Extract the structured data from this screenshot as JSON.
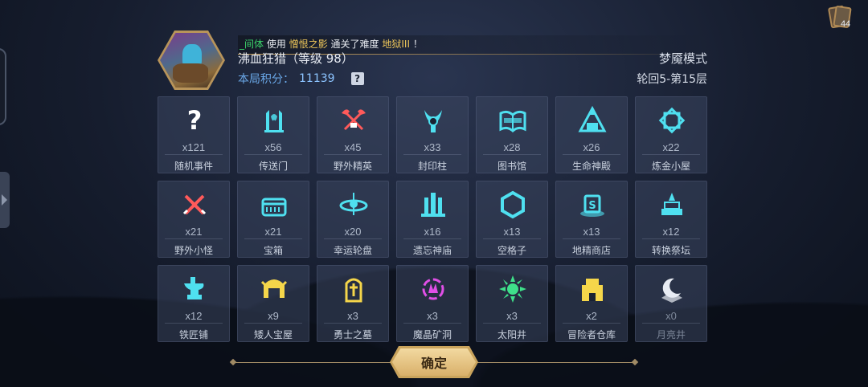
{
  "header": {
    "broadcast": {
      "player": "_间体",
      "used": "使用",
      "item": "憎恨之影",
      "middle": "通关了难度",
      "difficulty": "地狱III",
      "end": "！"
    },
    "player_name": "沸血狂猎（等级 98）",
    "mode": "梦魇模式",
    "score_label": "本局积分：",
    "score_value": "11139",
    "help_label": "?",
    "round": "轮回5-第15层",
    "cards_count": "44"
  },
  "events": [
    {
      "name": "随机事件",
      "count": "x121",
      "icon": "question-icon",
      "color": "#ffffff"
    },
    {
      "name": "传送门",
      "count": "x56",
      "icon": "portal-icon",
      "color": "#4fe0f0"
    },
    {
      "name": "野外精英",
      "count": "x45",
      "icon": "crossed-axes-icon",
      "color": "#ff5a5a"
    },
    {
      "name": "封印柱",
      "count": "x33",
      "icon": "seal-pillar-icon",
      "color": "#4fe0f0"
    },
    {
      "name": "图书馆",
      "count": "x28",
      "icon": "book-icon",
      "color": "#4fe0f0"
    },
    {
      "name": "生命神殿",
      "count": "x26",
      "icon": "temple-icon",
      "color": "#4fe0f0"
    },
    {
      "name": "炼金小屋",
      "count": "x22",
      "icon": "alchemy-icon",
      "color": "#4fe0f0"
    },
    {
      "name": "野外小怪",
      "count": "x21",
      "icon": "crossed-swords-icon",
      "color": "#ff5a5a"
    },
    {
      "name": "宝箱",
      "count": "x21",
      "icon": "chest-icon",
      "color": "#4fe0f0"
    },
    {
      "name": "幸运轮盘",
      "count": "x20",
      "icon": "wheel-icon",
      "color": "#4fe0f0"
    },
    {
      "name": "遗忘神庙",
      "count": "x16",
      "icon": "shrine-icon",
      "color": "#4fe0f0"
    },
    {
      "name": "空格子",
      "count": "x13",
      "icon": "hexagon-icon",
      "color": "#4fe0f0"
    },
    {
      "name": "地精商店",
      "count": "x13",
      "icon": "shop-icon",
      "color": "#4fe0f0"
    },
    {
      "name": "转换祭坛",
      "count": "x12",
      "icon": "altar-icon",
      "color": "#4fe0f0"
    },
    {
      "name": "铁匠铺",
      "count": "x12",
      "icon": "anvil-icon",
      "color": "#4fe0f0"
    },
    {
      "name": "矮人宝屋",
      "count": "x9",
      "icon": "helmet-icon",
      "color": "#f5d64a"
    },
    {
      "name": "勇士之墓",
      "count": "x3",
      "icon": "tomb-icon",
      "color": "#f5d64a"
    },
    {
      "name": "魔晶矿洞",
      "count": "x3",
      "icon": "crystal-icon",
      "color": "#e04fe6"
    },
    {
      "name": "太阳井",
      "count": "x3",
      "icon": "sun-icon",
      "color": "#3fe08a"
    },
    {
      "name": "冒险者仓库",
      "count": "x2",
      "icon": "warehouse-icon",
      "color": "#f5d64a"
    },
    {
      "name": "月亮井",
      "count": "x0",
      "icon": "moon-icon",
      "color": "#e8ecf3"
    }
  ],
  "footer": {
    "confirm_label": "确定"
  }
}
